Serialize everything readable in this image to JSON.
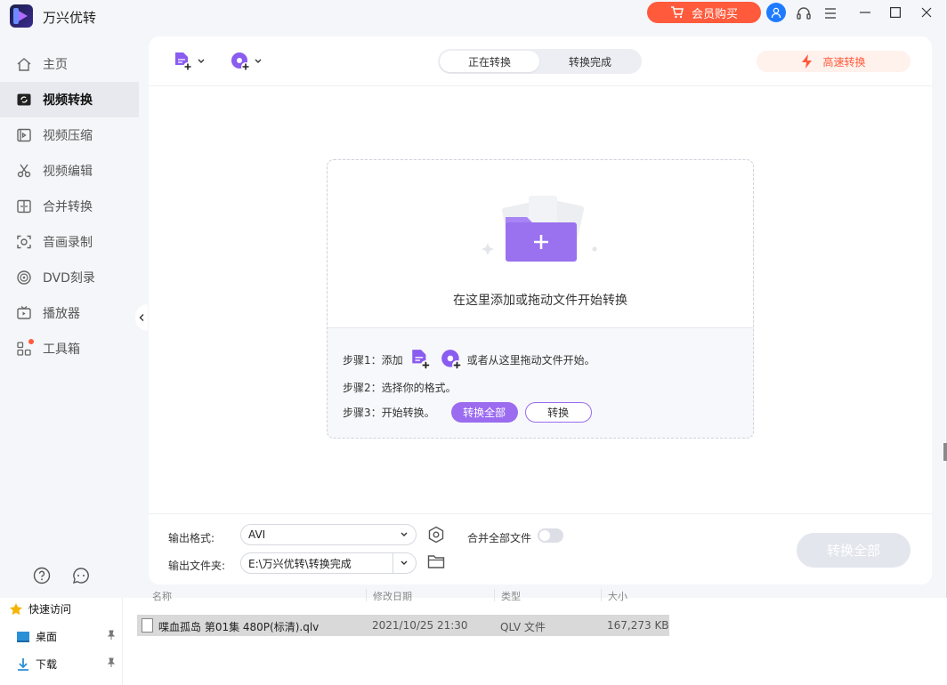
{
  "app": {
    "title": "万兴优转",
    "vip_label": "会员购买"
  },
  "sidebar": {
    "items": [
      {
        "label": "主页",
        "icon": "home-icon"
      },
      {
        "label": "视频转换",
        "icon": "video-convert-icon",
        "active": true
      },
      {
        "label": "视频压缩",
        "icon": "compress-icon"
      },
      {
        "label": "视频编辑",
        "icon": "scissors-icon"
      },
      {
        "label": "合并转换",
        "icon": "merge-icon"
      },
      {
        "label": "音画录制",
        "icon": "record-icon"
      },
      {
        "label": "DVD刻录",
        "icon": "disc-icon"
      },
      {
        "label": "播放器",
        "icon": "player-icon"
      },
      {
        "label": "工具箱",
        "icon": "toolbox-icon",
        "badge": true
      }
    ]
  },
  "toolbar": {
    "tab_converting": "正在转换",
    "tab_done": "转换完成",
    "fast_convert": "高速转换"
  },
  "dropzone": {
    "hint": "在这里添加或拖动文件开始转换",
    "step1_prefix": "步骤1：添加",
    "step1_suffix": "或者从这里拖动文件开始。",
    "step2": "步骤2：选择你的格式。",
    "step3": "步骤3：开始转换。",
    "convert_all": "转换全部",
    "convert": "转换"
  },
  "bottom": {
    "format_label": "输出格式:",
    "format_value": "AVI",
    "folder_label": "输出文件夹:",
    "folder_value": "E:\\万兴优转\\转换完成",
    "merge_label": "合并全部文件",
    "merge_on": false,
    "convert_all_btn": "转换全部"
  },
  "explorer": {
    "nav": [
      {
        "label": "快速访问",
        "icon": "star-icon"
      },
      {
        "label": "桌面",
        "icon": "desktop-icon",
        "pinned": true
      },
      {
        "label": "下载",
        "icon": "download-icon",
        "pinned": true
      }
    ],
    "columns": [
      "名称",
      "修改日期",
      "类型",
      "大小"
    ],
    "row": {
      "name": "喋血孤岛 第01集 480P(标清).qlv",
      "date": "2021/10/25 21:30",
      "type": "QLV 文件",
      "size": "167,273 KB"
    }
  },
  "colors": {
    "accent": "#9b6cf0",
    "vip": "#ff5a3c",
    "user": "#1e7bff"
  }
}
